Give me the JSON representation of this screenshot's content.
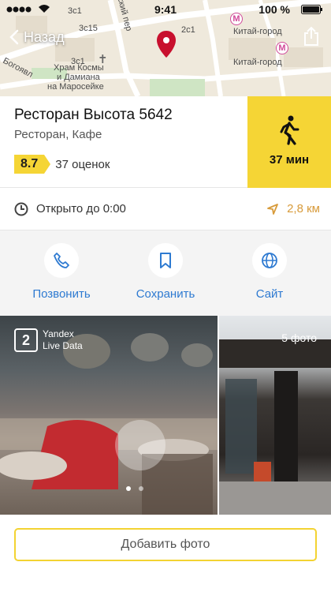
{
  "status_bar": {
    "time": "9:41",
    "battery": "100 %"
  },
  "nav": {
    "back_label": "Назад"
  },
  "map": {
    "labels": [
      "Китай-город",
      "Китай-город",
      "Храм Космы",
      "и Дамиана",
      "на Маросейке",
      "Богоявл",
      "3с15",
      "3с1",
      "3с1",
      "ский пер",
      "2с1"
    ]
  },
  "place": {
    "name": "Ресторан Высота 5642",
    "category": "Ресторан, Кафе",
    "rating": "8.7",
    "reviews": "37 оценок",
    "walk_time": "37 мин"
  },
  "hours": {
    "text": "Открыто до 0:00",
    "distance": "2,8 км"
  },
  "actions": [
    {
      "label": "Позвонить",
      "icon": "phone-icon"
    },
    {
      "label": "Сохранить",
      "icon": "bookmark-icon"
    },
    {
      "label": "Сайт",
      "icon": "globe-icon"
    }
  ],
  "photos": {
    "provider_line1": "Yandex",
    "provider_line2": "Live Data",
    "count": "5 фото"
  },
  "add_photo": {
    "label": "Добавить фото"
  },
  "colors": {
    "accent_yellow": "#f5d535",
    "link_blue": "#2e7ad1",
    "distance_orange": "#d89b3b",
    "pin_red": "#c8102e"
  }
}
